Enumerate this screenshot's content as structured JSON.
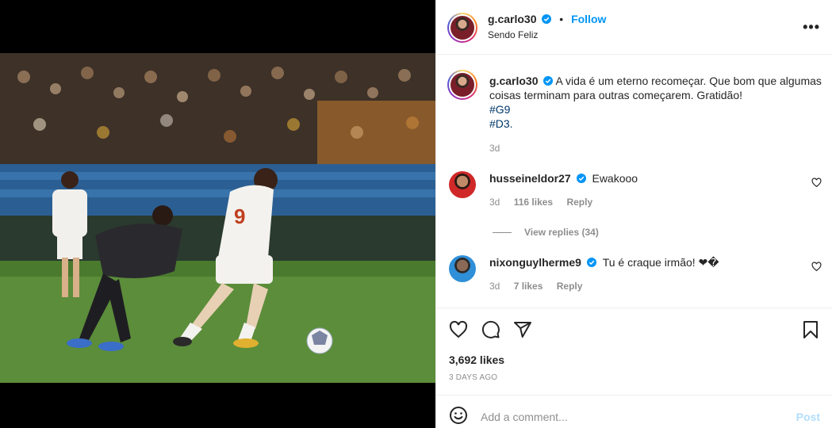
{
  "post": {
    "username": "g.carlo30",
    "follow_label": "Follow",
    "location": "Sendo Feliz",
    "more_label": "•••",
    "caption_text": "A vida é um eterno recomeçar. Que bom que algumas coisas terminam para outras começarem. Gratidão!",
    "hashtags": [
      "#G9",
      "#D3."
    ],
    "age": "3d",
    "likes": "3,692 likes",
    "date": "3 DAYS AGO"
  },
  "comments": [
    {
      "username": "husseineldor27",
      "text": "Ewakooo",
      "age": "3d",
      "likes": "116 likes",
      "reply_label": "Reply",
      "view_replies": "View replies (34)"
    },
    {
      "username": "nixonguylherme9",
      "text": "Tu é craque irmão! ❤�",
      "age": "3d",
      "likes": "7 likes",
      "reply_label": "Reply"
    }
  ],
  "add_comment": {
    "placeholder": "Add a comment...",
    "post_label": "Post"
  },
  "colors": {
    "accent": "#0095f6",
    "muted": "#8e8e8e",
    "hashtag": "#00376b",
    "post_disabled": "#b2dffc"
  },
  "icons": [
    "verified-badge-icon",
    "more-options-icon",
    "heart-icon",
    "comment-icon",
    "share-icon",
    "bookmark-icon",
    "emoji-icon"
  ]
}
